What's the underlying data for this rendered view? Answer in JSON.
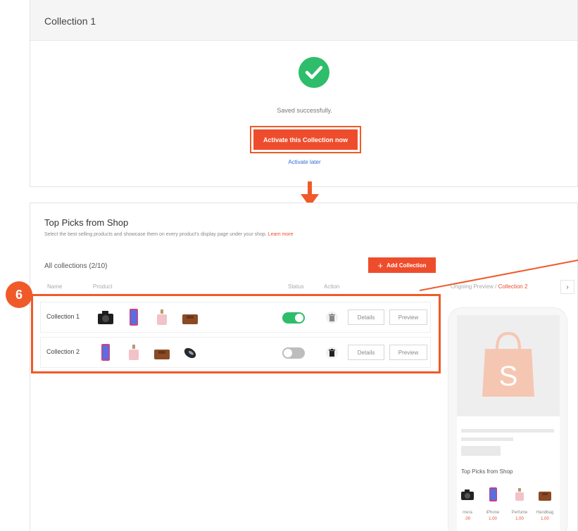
{
  "top_panel": {
    "title": "Collection 1",
    "status_message": "Saved successfully.",
    "activate_now_label": "Activate this Collection now",
    "activate_later_label": "Activate later"
  },
  "shop_section": {
    "title": "Top Picks from Shop",
    "description": "Select the best selling products and showcase them on every product's display page under your shop.",
    "learn_more": "Learn more",
    "all_collections": "All collections (2/10)",
    "add_collection_label": "Add Collection",
    "headers": {
      "name": "Name",
      "product": "Product",
      "status": "Status",
      "action": "Action"
    }
  },
  "step_number": "6",
  "collections": [
    {
      "name": "Collection 1",
      "active": true,
      "products": [
        "camera",
        "iphone",
        "perfume",
        "handbag"
      ],
      "details_label": "Details",
      "preview_label": "Preview"
    },
    {
      "name": "Collection 2",
      "active": false,
      "products": [
        "iphone",
        "perfume",
        "handbag",
        "mouse"
      ],
      "details_label": "Details",
      "preview_label": "Preview"
    }
  ],
  "preview_panel": {
    "label_prefix": "Ongoing Preview /",
    "label_current": "Collection 2",
    "chevron": "›",
    "mini_title": "Top Picks from Shop",
    "mini_products": [
      {
        "name": "mera",
        "price": ".00"
      },
      {
        "name": "iPhone",
        "price": "1.00"
      },
      {
        "name": "Perfume",
        "price": "1.00"
      },
      {
        "name": "Handbag",
        "price": "1.00"
      }
    ]
  },
  "colors": {
    "brand": "#ee4d2d",
    "highlight": "#f05a28",
    "success": "#2ebd6b",
    "link": "#2f6ed8"
  }
}
